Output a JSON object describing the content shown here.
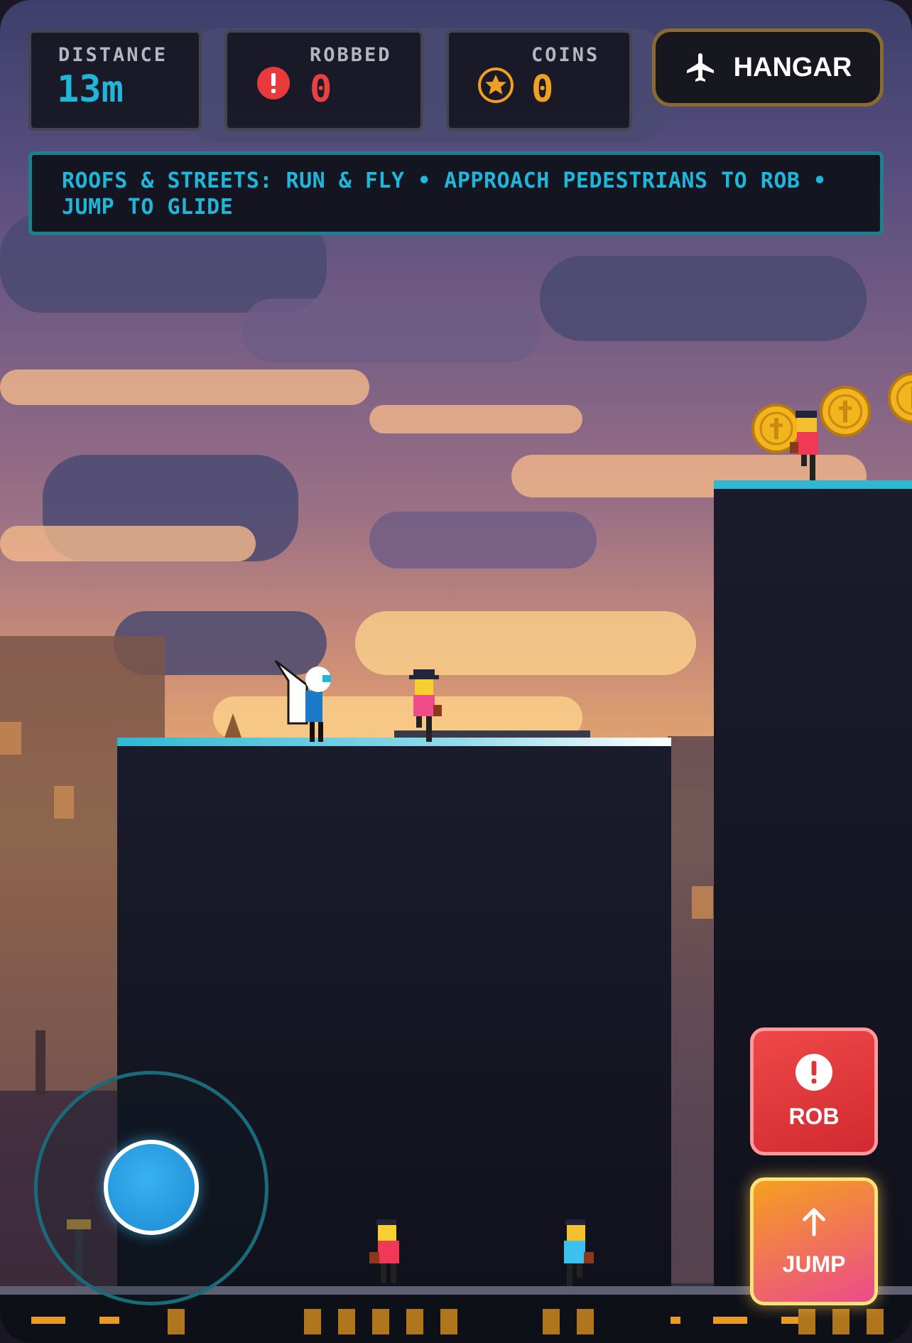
{
  "hud": {
    "distance": {
      "label": "DISTANCE",
      "value": "13m",
      "color": "#1fb6d9"
    },
    "robbed": {
      "label": "ROBBED",
      "value": "0",
      "color": "#e94040",
      "icon": "alert-circle-icon"
    },
    "coins": {
      "label": "COINS",
      "value": "0",
      "color": "#f0a020",
      "icon": "star-coin-icon"
    },
    "hangar": {
      "label": "HANGAR",
      "icon": "airplane-icon"
    }
  },
  "hint": {
    "text": "ROOFS & STREETS: RUN & FLY • APPROACH PEDESTRIANS TO ROB • JUMP TO GLIDE"
  },
  "controls": {
    "rob": {
      "label": "ROB",
      "icon": "alert-circle-icon"
    },
    "jump": {
      "label": "JUMP",
      "icon": "arrow-up-icon"
    },
    "joystick": {
      "icon": "joystick-knob"
    }
  },
  "colors": {
    "accent_cyan": "#1fb6d9",
    "rob_red": "#e03434",
    "coin_gold": "#f0a020"
  }
}
